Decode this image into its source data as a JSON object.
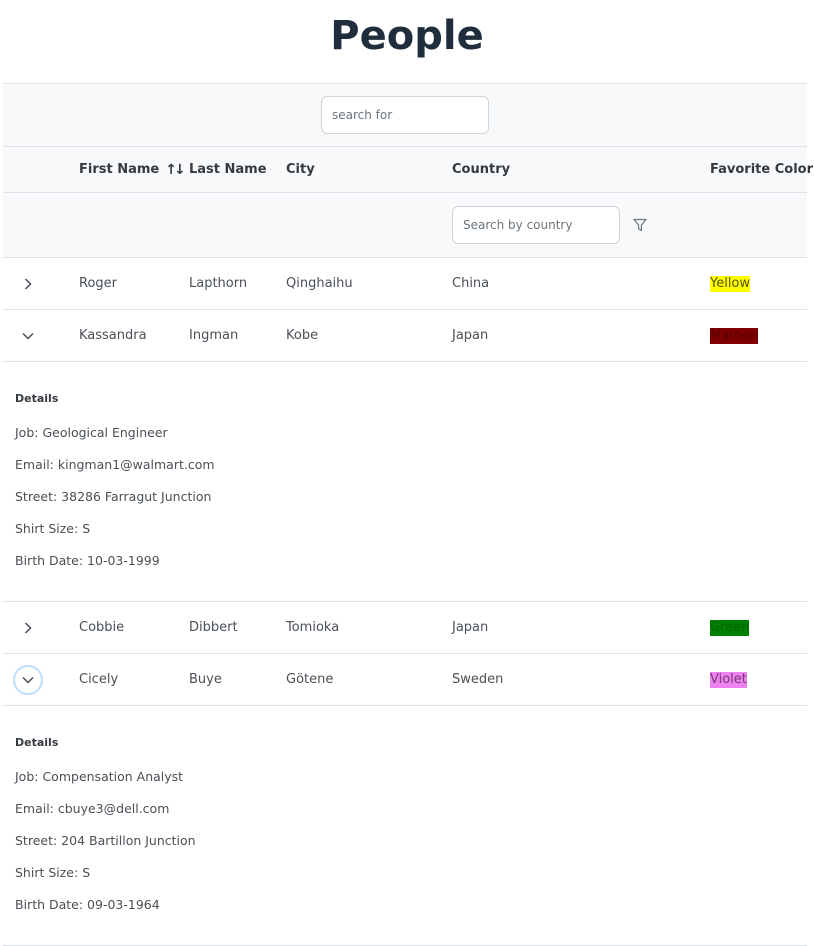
{
  "page": {
    "title": "People"
  },
  "toolbar": {
    "search_placeholder": "search for"
  },
  "columns": {
    "first_name": "First Name",
    "last_name": "Last Name",
    "city": "City",
    "country": "Country",
    "favorite_color": "Favorite Color"
  },
  "filters": {
    "country_placeholder": "Search by country"
  },
  "rows": [
    {
      "first": "Roger",
      "last": "Lapthorn",
      "city": "Qinghaihu",
      "country": "China",
      "color": "Yellow",
      "color_bg": "#ffff00",
      "color_fg": "#555500",
      "expanded": false
    },
    {
      "first": "Kassandra",
      "last": "Ingman",
      "city": "Kobe",
      "country": "Japan",
      "color": "Maroon",
      "color_bg": "#800000",
      "color_fg": "#5a0000",
      "expanded": true,
      "details": {
        "title": "Details",
        "job": "Job: Geological Engineer",
        "email": "Email: kingman1@walmart.com",
        "street": "Street: 38286 Farragut Junction",
        "shirt": "Shirt Size: S",
        "birth": "Birth Date: 10-03-1999"
      }
    },
    {
      "first": "Cobbie",
      "last": "Dibbert",
      "city": "Tomioka",
      "country": "Japan",
      "color": "Green",
      "color_bg": "#008000",
      "color_fg": "#006400",
      "expanded": false
    },
    {
      "first": "Cicely",
      "last": "Buye",
      "city": "Götene",
      "country": "Sweden",
      "color": "Violet",
      "color_bg": "#ee82ee",
      "color_fg": "#7a3a7a",
      "expanded": true,
      "focused": true,
      "details": {
        "title": "Details",
        "job": "Job: Compensation Analyst",
        "email": "Email: cbuye3@dell.com",
        "street": "Street: 204 Bartillon Junction",
        "shirt": "Shirt Size: S",
        "birth": "Birth Date: 09-03-1964"
      }
    }
  ],
  "colors": {
    "border": "#dee2e6",
    "header_bg": "#f8f9fa",
    "title": "#1f2d3d",
    "focus_ring": "#bfdbfe"
  }
}
